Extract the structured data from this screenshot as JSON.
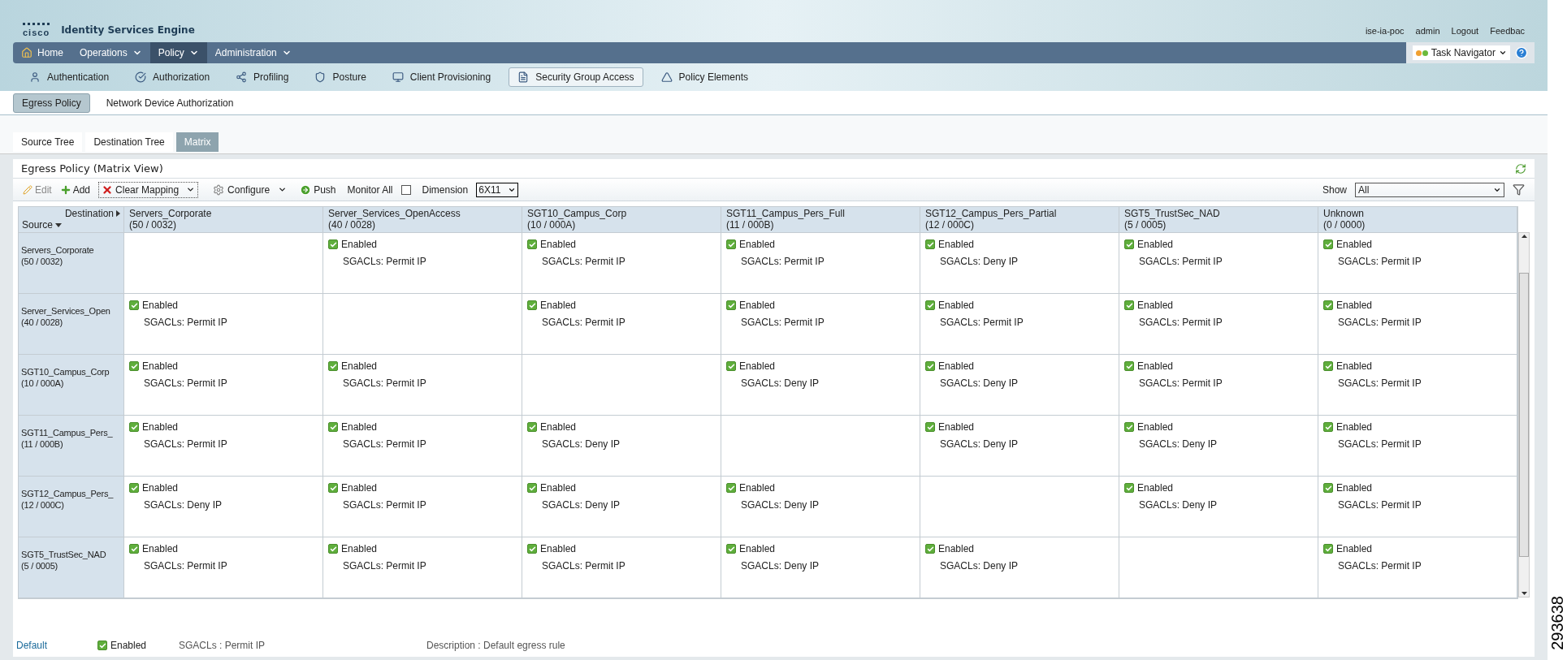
{
  "header": {
    "logo": "cisco",
    "product": "Identity Services Engine",
    "links": [
      "ise-ia-poc",
      "admin",
      "Logout",
      "Feedbac"
    ]
  },
  "nav": [
    {
      "label": "Home",
      "kind": "home",
      "selected": false
    },
    {
      "label": "Operations",
      "kind": "menu",
      "selected": false
    },
    {
      "label": "Policy",
      "kind": "menu",
      "selected": true
    },
    {
      "label": "Administration",
      "kind": "menu",
      "selected": false
    }
  ],
  "task_navigator": "Task Navigator",
  "subnav": [
    {
      "label": "Authentication",
      "selected": false
    },
    {
      "label": "Authorization",
      "selected": false
    },
    {
      "label": "Profiling",
      "selected": false
    },
    {
      "label": "Posture",
      "selected": false
    },
    {
      "label": "Client Provisioning",
      "selected": false
    },
    {
      "label": "Security Group Access",
      "selected": true
    },
    {
      "label": "Policy Elements",
      "selected": false
    }
  ],
  "policy_tabs": [
    {
      "label": "Egress Policy",
      "selected": true
    },
    {
      "label": "Network Device Authorization",
      "selected": false
    }
  ],
  "view_tabs": [
    {
      "label": "Source Tree",
      "selected": false
    },
    {
      "label": "Destination Tree",
      "selected": false
    },
    {
      "label": "Matrix",
      "selected": true
    }
  ],
  "panel_title": "Egress Policy (Matrix View)",
  "toolbar": {
    "edit": {
      "label": "Edit",
      "disabled": true
    },
    "add": "Add",
    "clear_mapping": "Clear Mapping",
    "configure": "Configure",
    "push": "Push",
    "monitor_all": {
      "label": "Monitor All",
      "checked": false
    },
    "dimension": {
      "label": "Dimension",
      "value": "6X11"
    },
    "show": {
      "label": "Show",
      "value": "All"
    }
  },
  "matrix": {
    "destination_label": "Destination",
    "source_label": "Source",
    "columns": [
      {
        "name": "Servers_Corporate",
        "code": "(50 / 0032)"
      },
      {
        "name": "Server_Services_OpenAccess",
        "code": "(40 / 0028)"
      },
      {
        "name": "SGT10_Campus_Corp",
        "code": "(10 / 000A)"
      },
      {
        "name": "SGT11_Campus_Pers_Full",
        "code": "(11 / 000B)"
      },
      {
        "name": "SGT12_Campus_Pers_Partial",
        "code": "(12 / 000C)"
      },
      {
        "name": "SGT5_TrustSec_NAD",
        "code": "(5 / 0005)"
      },
      {
        "name": "Unknown",
        "code": "(0 / 0000)"
      }
    ],
    "rows": [
      {
        "name": "Servers_Corporate",
        "code": "(50 / 0032)",
        "cells": [
          null,
          {
            "enabled": true,
            "label": "Enabled",
            "sgacl": "SGACLs: Permit IP"
          },
          {
            "enabled": true,
            "label": "Enabled",
            "sgacl": "SGACLs: Permit IP"
          },
          {
            "enabled": true,
            "label": "Enabled",
            "sgacl": "SGACLs: Permit IP"
          },
          {
            "enabled": true,
            "label": "Enabled",
            "sgacl": "SGACLs: Deny IP"
          },
          {
            "enabled": true,
            "label": "Enabled",
            "sgacl": "SGACLs: Permit IP"
          },
          {
            "enabled": true,
            "label": "Enabled",
            "sgacl": "SGACLs: Permit IP"
          }
        ]
      },
      {
        "name": "Server_Services_Open",
        "code": "(40 / 0028)",
        "cells": [
          {
            "enabled": true,
            "label": "Enabled",
            "sgacl": "SGACLs: Permit IP"
          },
          null,
          {
            "enabled": true,
            "label": "Enabled",
            "sgacl": "SGACLs: Permit IP"
          },
          {
            "enabled": true,
            "label": "Enabled",
            "sgacl": "SGACLs: Permit IP"
          },
          {
            "enabled": true,
            "label": "Enabled",
            "sgacl": "SGACLs: Permit IP"
          },
          {
            "enabled": true,
            "label": "Enabled",
            "sgacl": "SGACLs: Permit IP"
          },
          {
            "enabled": true,
            "label": "Enabled",
            "sgacl": "SGACLs: Permit IP"
          }
        ]
      },
      {
        "name": "SGT10_Campus_Corp",
        "code": "(10 / 000A)",
        "cells": [
          {
            "enabled": true,
            "label": "Enabled",
            "sgacl": "SGACLs: Permit IP"
          },
          {
            "enabled": true,
            "label": "Enabled",
            "sgacl": "SGACLs: Permit IP"
          },
          null,
          {
            "enabled": true,
            "label": "Enabled",
            "sgacl": "SGACLs: Deny IP"
          },
          {
            "enabled": true,
            "label": "Enabled",
            "sgacl": "SGACLs: Deny IP"
          },
          {
            "enabled": true,
            "label": "Enabled",
            "sgacl": "SGACLs: Permit IP"
          },
          {
            "enabled": true,
            "label": "Enabled",
            "sgacl": "SGACLs: Permit IP"
          }
        ]
      },
      {
        "name": "SGT11_Campus_Pers_",
        "code": "(11 / 000B)",
        "cells": [
          {
            "enabled": true,
            "label": "Enabled",
            "sgacl": "SGACLs: Permit IP"
          },
          {
            "enabled": true,
            "label": "Enabled",
            "sgacl": "SGACLs: Permit IP"
          },
          {
            "enabled": true,
            "label": "Enabled",
            "sgacl": "SGACLs: Deny IP"
          },
          null,
          {
            "enabled": true,
            "label": "Enabled",
            "sgacl": "SGACLs: Deny IP"
          },
          {
            "enabled": true,
            "label": "Enabled",
            "sgacl": "SGACLs: Deny IP"
          },
          {
            "enabled": true,
            "label": "Enabled",
            "sgacl": "SGACLs: Permit IP"
          }
        ]
      },
      {
        "name": "SGT12_Campus_Pers_",
        "code": "(12 / 000C)",
        "cells": [
          {
            "enabled": true,
            "label": "Enabled",
            "sgacl": "SGACLs: Deny IP"
          },
          {
            "enabled": true,
            "label": "Enabled",
            "sgacl": "SGACLs: Permit IP"
          },
          {
            "enabled": true,
            "label": "Enabled",
            "sgacl": "SGACLs: Deny IP"
          },
          {
            "enabled": true,
            "label": "Enabled",
            "sgacl": "SGACLs: Deny IP"
          },
          null,
          {
            "enabled": true,
            "label": "Enabled",
            "sgacl": "SGACLs: Deny IP"
          },
          {
            "enabled": true,
            "label": "Enabled",
            "sgacl": "SGACLs: Permit IP"
          }
        ]
      },
      {
        "name": "SGT5_TrustSec_NAD",
        "code": "(5 / 0005)",
        "cells": [
          {
            "enabled": true,
            "label": "Enabled",
            "sgacl": "SGACLs: Permit IP"
          },
          {
            "enabled": true,
            "label": "Enabled",
            "sgacl": "SGACLs: Permit IP"
          },
          {
            "enabled": true,
            "label": "Enabled",
            "sgacl": "SGACLs: Permit IP"
          },
          {
            "enabled": true,
            "label": "Enabled",
            "sgacl": "SGACLs: Deny IP"
          },
          {
            "enabled": true,
            "label": "Enabled",
            "sgacl": "SGACLs: Deny IP"
          },
          null,
          {
            "enabled": true,
            "label": "Enabled",
            "sgacl": "SGACLs: Permit IP"
          }
        ]
      }
    ]
  },
  "default_rule": {
    "name": "Default",
    "enabled": true,
    "label": "Enabled",
    "sgacl": "SGACLs : Permit IP",
    "description": "Description : Default egress rule"
  },
  "figure_id": "293638"
}
